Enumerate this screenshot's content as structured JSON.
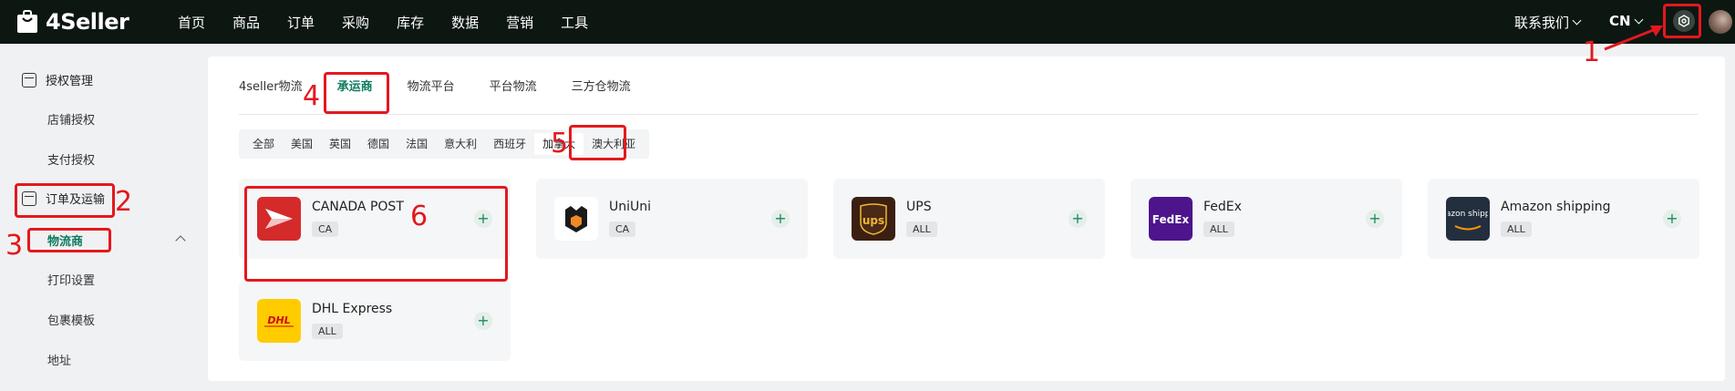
{
  "topbar": {
    "logo_text": "4Seller",
    "nav": [
      "首页",
      "商品",
      "订单",
      "采购",
      "库存",
      "数据",
      "营销",
      "工具"
    ],
    "contact_label": "联系我们",
    "language": "CN"
  },
  "sidebar": {
    "groups": [
      {
        "label": "授权管理",
        "icon": "key-card-icon",
        "items": [
          "店铺授权",
          "支付授权"
        ]
      },
      {
        "label": "订单及运输",
        "icon": "clipboard-icon",
        "items": [
          "物流商",
          "打印设置",
          "包裹模板",
          "地址"
        ]
      }
    ],
    "active_item": "物流商"
  },
  "tabs": [
    "4seller物流",
    "承运商",
    "物流平台",
    "平台物流",
    "三方仓物流"
  ],
  "active_tab": "承运商",
  "regions": [
    "全部",
    "美国",
    "英国",
    "德国",
    "法国",
    "意大利",
    "西班牙",
    "加拿大",
    "澳大利亚"
  ],
  "active_region": "加拿大",
  "carriers": [
    {
      "name": "CANADA POST",
      "badge": "CA",
      "logo": "canada-post-logo"
    },
    {
      "name": "UniUni",
      "badge": "CA",
      "logo": "uniuni-logo"
    },
    {
      "name": "UPS",
      "badge": "ALL",
      "logo": "ups-logo",
      "logo_text": "ups"
    },
    {
      "name": "FedEx",
      "badge": "ALL",
      "logo": "fedex-logo",
      "logo_text": "FedEx"
    },
    {
      "name": "Amazon shipping",
      "badge": "ALL",
      "logo": "amazon-shipping-logo",
      "logo_text": "amazon shipping"
    },
    {
      "name": "DHL Express",
      "badge": "ALL",
      "logo": "dhl-logo",
      "logo_text": "DHL"
    }
  ],
  "add_symbol": "+",
  "annotations": [
    "1",
    "2",
    "3",
    "4",
    "5",
    "6"
  ],
  "colors": {
    "accent": "#0e7a5f",
    "topbar": "#0c1712",
    "annotation": "#e3181e"
  }
}
